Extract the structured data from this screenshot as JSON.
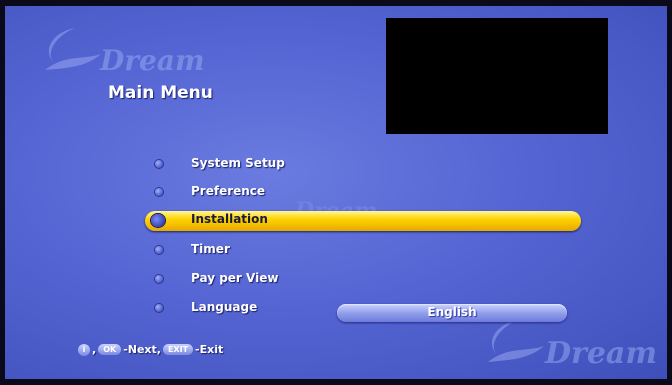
{
  "title": "Main Menu",
  "watermark": "Dream",
  "menu": {
    "items": [
      {
        "label": "System Setup",
        "selected": false
      },
      {
        "label": "Preference",
        "selected": false
      },
      {
        "label": "Installation",
        "selected": true
      },
      {
        "label": "Timer",
        "selected": false
      },
      {
        "label": "Pay per View",
        "selected": false
      },
      {
        "label": "Language",
        "selected": false
      }
    ],
    "language_value": "English"
  },
  "hint": {
    "key_info": "i",
    "key_ok": "OK",
    "next_label": "-Next,",
    "key_exit": "EXIT",
    "exit_label": "-Exit"
  },
  "colors": {
    "background": "#5565d3",
    "highlight": "#ffd400",
    "preview": "#000000"
  }
}
